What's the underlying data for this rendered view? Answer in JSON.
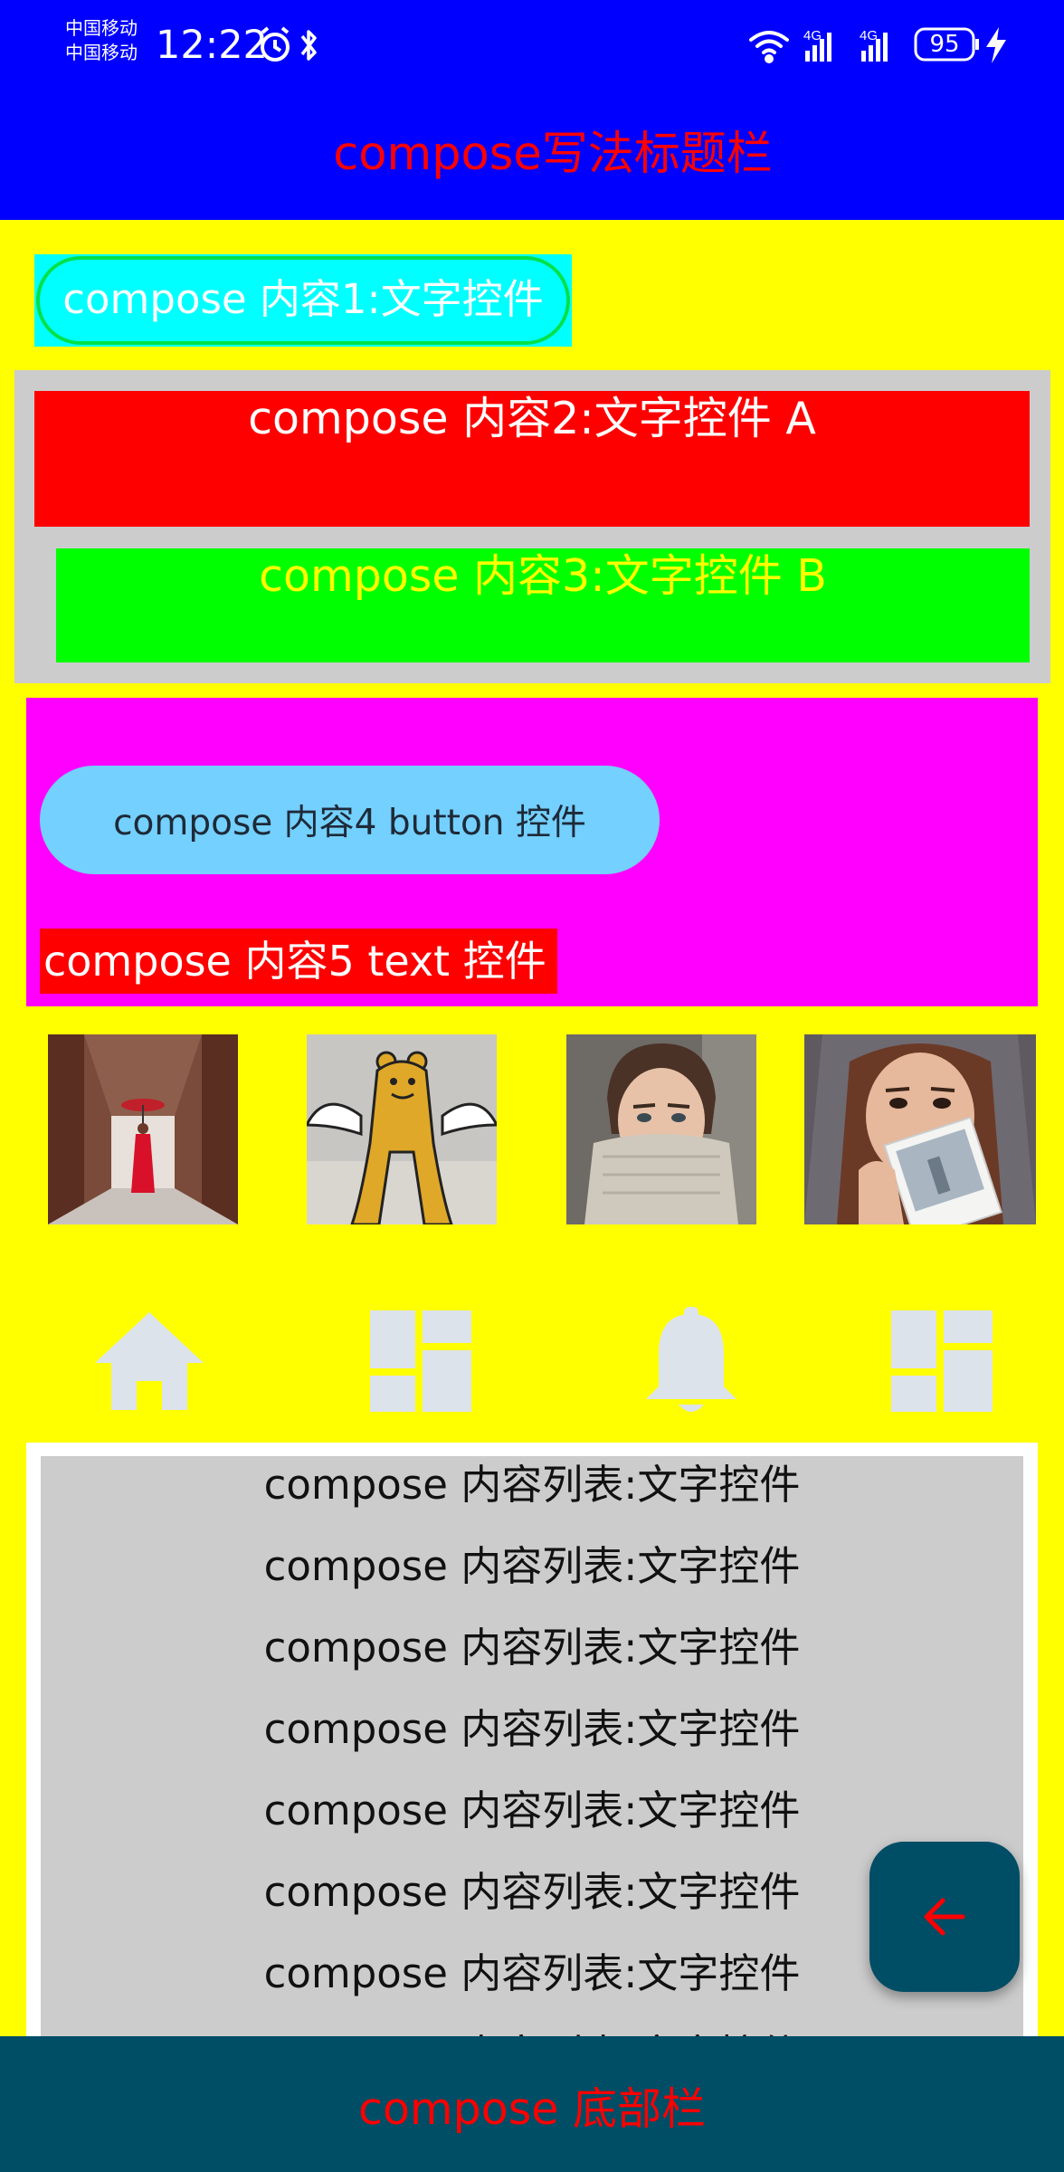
{
  "status_bar": {
    "carrier_1": "中国移动",
    "carrier_2": "中国移动",
    "time": "12:22",
    "battery": "95",
    "icons": [
      "alarm-icon",
      "bluetooth-icon",
      "wifi-icon",
      "signal-4g-icon",
      "signal-4g-icon",
      "battery-icon",
      "charging-icon"
    ]
  },
  "title_bar": {
    "title": "compose写法标题栏"
  },
  "content1": {
    "text": "compose 内容1:文字控件"
  },
  "content2": {
    "text": "compose 内容2:文字控件 A"
  },
  "content3": {
    "text": "compose 内容3:文字控件 B"
  },
  "content4": {
    "button_label": "compose 内容4 button 控件"
  },
  "content5": {
    "text": "compose 内容5 text 控件"
  },
  "images": [
    "photo-monk-umbrella",
    "photo-bear-graffiti",
    "photo-woman-sweater",
    "photo-woman-polaroid"
  ],
  "nav_icons": [
    "home-icon",
    "dashboard-icon",
    "bell-icon",
    "dashboard-icon"
  ],
  "list": {
    "items": [
      "compose 内容列表:文字控件",
      "compose 内容列表:文字控件",
      "compose 内容列表:文字控件",
      "compose 内容列表:文字控件",
      "compose 内容列表:文字控件",
      "compose 内容列表:文字控件",
      "compose 内容列表:文字控件",
      "compose 内容列表:文字控件"
    ]
  },
  "fab": {
    "icon": "arrow-back-icon"
  },
  "bottom_bar": {
    "text": "compose 底部栏"
  },
  "colors": {
    "title_bar_bg": "#0000FF",
    "title_text": "#FF0000",
    "page_bg": "#FFFF00",
    "content1_bg": "#00FFFF",
    "content1_border": "#00E14A",
    "group_gray": "#CCCCCC",
    "content2_bg": "#FF0000",
    "content3_bg": "#00FF00",
    "content3_text": "#FFFF00",
    "magenta_bg": "#FF00FF",
    "button_bg": "#74D0FF",
    "nav_icon": "#DDE3EA",
    "bottom_bar_bg": "#004D66",
    "bottom_text": "#FF0000"
  }
}
